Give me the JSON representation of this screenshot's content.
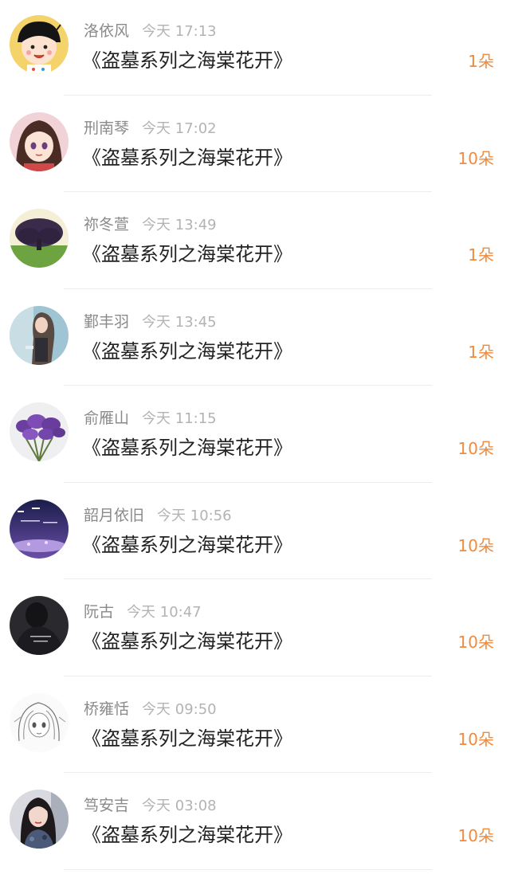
{
  "list": {
    "items": [
      {
        "name": "洛依风",
        "time": "今天 17:13",
        "title": "《盗墓系列之海棠花开》",
        "count": "1朵",
        "avatar_icon": "cartoon-girl-avatar"
      },
      {
        "name": "刑南琴",
        "time": "今天 17:02",
        "title": "《盗墓系列之海棠花开》",
        "count": "10朵",
        "avatar_icon": "anime-girl-avatar"
      },
      {
        "name": "祢冬萱",
        "time": "今天 13:49",
        "title": "《盗墓系列之海棠花开》",
        "count": "1朵",
        "avatar_icon": "tree-avatar"
      },
      {
        "name": "鄞丰羽",
        "time": "今天 13:45",
        "title": "《盗墓系列之海棠花开》",
        "count": "1朵",
        "avatar_icon": "woman-photo-avatar"
      },
      {
        "name": "俞雁山",
        "time": "今天 11:15",
        "title": "《盗墓系列之海棠花开》",
        "count": "10朵",
        "avatar_icon": "lavender-flowers-avatar"
      },
      {
        "name": "韶月依旧",
        "time": "今天 10:56",
        "title": "《盗墓系列之海棠花开》",
        "count": "10朵",
        "avatar_icon": "night-sky-text-avatar"
      },
      {
        "name": "阮古",
        "time": "今天 10:47",
        "title": "《盗墓系列之海棠花开》",
        "count": "10朵",
        "avatar_icon": "dark-person-avatar"
      },
      {
        "name": "桥雍恬",
        "time": "今天 09:50",
        "title": "《盗墓系列之海棠花开》",
        "count": "10朵",
        "avatar_icon": "sketch-girl-avatar"
      },
      {
        "name": "笃安吉",
        "time": "今天 03:08",
        "title": "《盗墓系列之海棠花开》",
        "count": "10朵",
        "avatar_icon": "woman-portrait-avatar"
      }
    ]
  }
}
